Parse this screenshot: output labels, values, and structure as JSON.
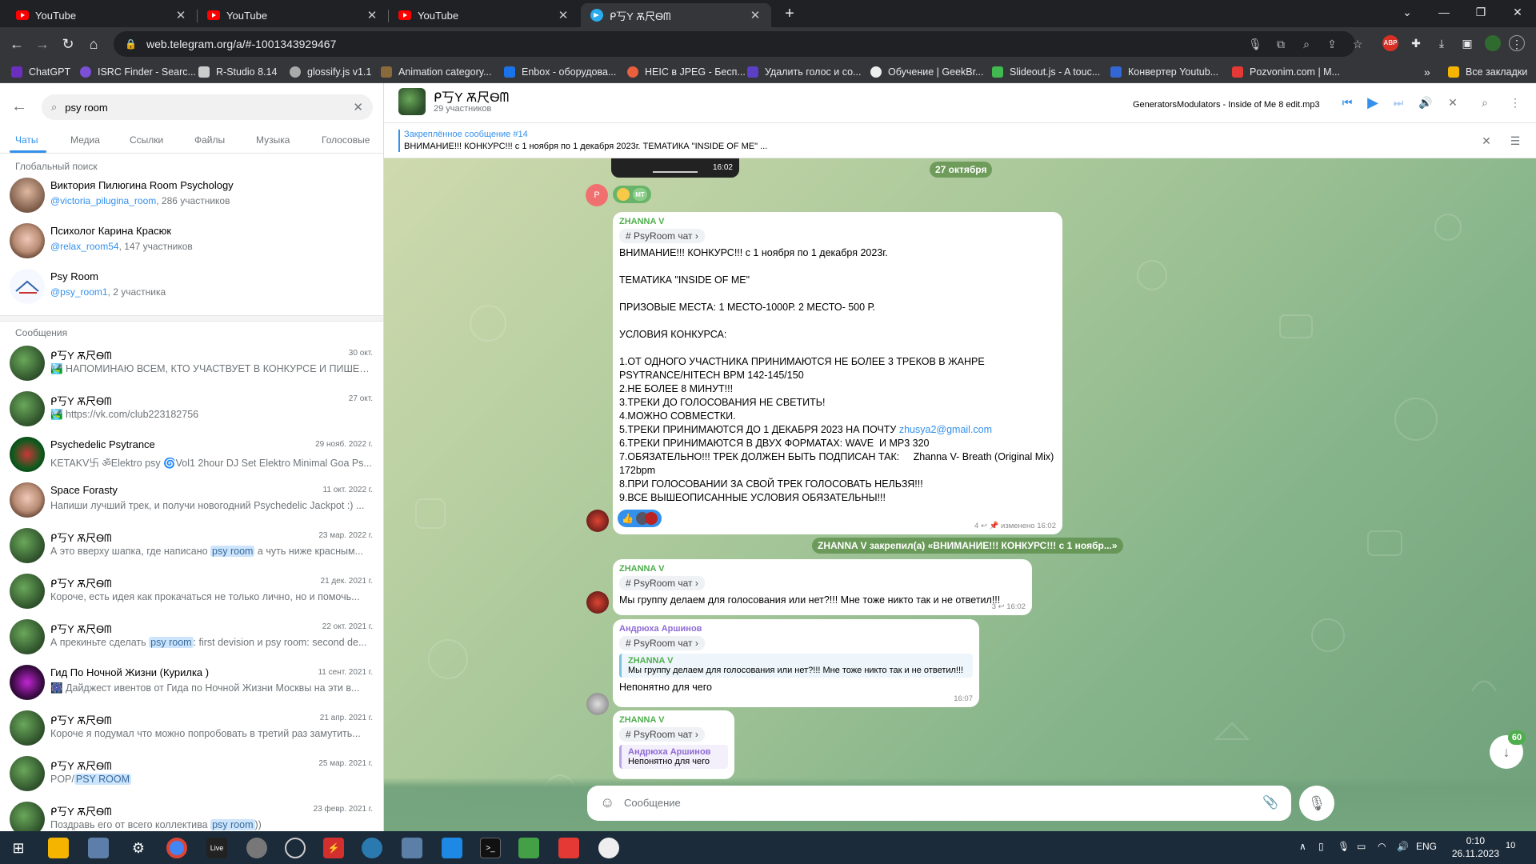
{
  "browser": {
    "tabs": [
      {
        "title": "YouTube",
        "type": "youtube"
      },
      {
        "title": "YouTube",
        "type": "youtube"
      },
      {
        "title": "YouTube",
        "type": "youtube"
      },
      {
        "title": "ᑭ丂Y Ѫ尺Ѳᗰ",
        "type": "telegram",
        "active": true
      }
    ],
    "url": "web.telegram.org/a/#-1001343929467",
    "bookmarks": [
      "ChatGPT",
      "ISRC Finder - Searc...",
      "R-Studio 8.14",
      "glossify.js v1.1",
      "Animation category...",
      "Enbox - оборудова...",
      "HEIC в JPEG - Бесп...",
      "Удалить голос и со...",
      "Обучение | GeekBr...",
      "Slideout.js - A touc...",
      "Конвертер Youtub...",
      "Pozvonim.com | М..."
    ],
    "bookmarks_more": "»",
    "all_bookmarks": "Все закладки"
  },
  "left": {
    "search_value": "psy room",
    "filter_tabs": [
      "Чаты",
      "Медиа",
      "Ссылки",
      "Файлы",
      "Музыка",
      "Голосовые"
    ],
    "global_title": "Глобальный поиск",
    "global": [
      {
        "name": "Виктория Пилюгина Room Psychology",
        "link": "@victoria_pilugina_room",
        "extra": ", 286 участников"
      },
      {
        "name": "Психолог Карина Красюк",
        "link": "@relax_room54",
        "extra": ", 147 участников"
      },
      {
        "name": "Psy Room",
        "link": "@psy_room1",
        "extra": ", 2 участника"
      }
    ],
    "messages_title": "Сообщения",
    "messages": [
      {
        "name": "ᑭ丂Y Ѫ尺Ѳᗰ",
        "date": "30 окт.",
        "pre": "🏞️ НАПОМИНАЮ ВСЕМ, КТО УЧАСТВУЕТ В КОНКУРСЕ И ПИШЕТ ...",
        "hl": "",
        "post": ""
      },
      {
        "name": "ᑭ丂Y Ѫ尺Ѳᗰ",
        "date": "27 окт.",
        "pre": "🏞️ https://vk.com/club223182756",
        "hl": "",
        "post": ""
      },
      {
        "name": "Psychedelic Psytrance",
        "date": "29 нояб. 2022 г.",
        "pre": "KETAKV卐 ॐElektro psy 🌀Vol1 2hour DJ Set Elektro Minimal Goa Ps...",
        "hl": "",
        "post": ""
      },
      {
        "name": "Space Forasty",
        "date": "11 окт. 2022 г.",
        "pre": "Напиши лучший трек, и получи новогодний Psychedelic Jackpot :) ...",
        "hl": "",
        "post": ""
      },
      {
        "name": "ᑭ丂Y Ѫ尺Ѳᗰ",
        "date": "23 мар. 2022 г.",
        "pre": "А это вверху шапка, где написано ",
        "hl": "psy room",
        "post": " а чуть ниже красным..."
      },
      {
        "name": "ᑭ丂Y Ѫ尺Ѳᗰ",
        "date": "21 дек. 2021 г.",
        "pre": "Короче, есть идея как прокачаться не только лично, но и помочь...",
        "hl": "",
        "post": ""
      },
      {
        "name": "ᑭ丂Y Ѫ尺Ѳᗰ",
        "date": "22 окт. 2021 г.",
        "pre": "А прекиньте сделать ",
        "hl": "psy room",
        "post": ": first devision и psy room: second de..."
      },
      {
        "name": "Гид По Ночной Жизни (Курилка )",
        "date": "11 сент. 2021 г.",
        "pre": "🎆 Дайджест ивентов от Гида по Ночной Жизни Москвы на эти в...",
        "hl": "",
        "post": ""
      },
      {
        "name": "ᑭ丂Y Ѫ尺Ѳᗰ",
        "date": "21 апр. 2021 г.",
        "pre": "Короче я подумал что можно попробовать в третий раз замутить...",
        "hl": "",
        "post": ""
      },
      {
        "name": "ᑭ丂Y Ѫ尺Ѳᗰ",
        "date": "25 мар. 2021 г.",
        "pre": "POP/",
        "hl": "PSY ROOM",
        "post": ""
      },
      {
        "name": "ᑭ丂Y Ѫ尺Ѳᗰ",
        "date": "23 февр. 2021 г.",
        "pre": "Поздравь его от всего коллектива ",
        "hl": "psy room",
        "post": "))"
      }
    ]
  },
  "chat": {
    "title": "ᑭ丂Y Ѫ尺Ѳᗰ",
    "members": "29 участников",
    "audio": "GeneratorsModulators - Inside of Me 8 edit.mp3",
    "pinned_title": "Закреплённое сообщение #14",
    "pinned_text": "ВНИМАНИЕ!!! КОНКУРС!!! с 1 ноября по 1 декабря 2023г. ТЕМАТИКА \"INSIDE OF ME\" ...",
    "video_time": "16:02",
    "reaction_small": "МТ",
    "date_chip": "27 октября",
    "post": {
      "author": "ZHANNA V",
      "topic": "PsyRoom чат",
      "line1": "ВНИМАНИЕ!!! КОНКУРС!!! с 1 ноября по 1 декабря 2023г.",
      "line2": "ТЕМАТИКА \"INSIDE OF ME\"",
      "line3": "ПРИЗОВЫЕ МЕСТА: 1 МЕСТО-1000Р. 2 МЕСТО- 500 Р.",
      "line4": "УСЛОВИЯ КОНКУРСА:",
      "line5": "1.ОТ ОДНОГО УЧАСТНИКА ПРИНИМАЮТСЯ НЕ БОЛЕЕ 3 ТРЕКОВ В ЖАНРЕ PSYTRANCE/HITECH BPM 142-145/150",
      "line6": "2.НЕ БОЛЕЕ 8 МИНУТ!!!",
      "line7": "3.ТРЕКИ ДО ГОЛОСОВАНИЯ НЕ СВЕТИТЬ!",
      "line8": "4.МОЖНО СОВМЕСТКИ.",
      "line9": "5.ТРЕКИ ПРИНИМАЮТСЯ ДО 1 ДЕКАБРЯ 2023 НА ПОЧТУ ",
      "email": "zhusya2@gmail.com",
      "line10": "6.ТРЕКИ ПРИНИМАЮТСЯ В ДВУХ ФОРМАТАХ: WAVE  И МР3 320",
      "line11": "7.ОБЯЗАТЕЛЬНО!!! ТРЕК ДОЛЖЕН БЫТЬ ПОДПИСАН ТАК:     Zhanna V- Breath (Original Mix) 172bpm",
      "line12": "8.ПРИ ГОЛОСОВАНИИ ЗА СВОЙ ТРЕК ГОЛОСОВАТЬ НЕЛЬЗЯ!!!",
      "line13": "9.ВСЕ ВЫШЕОПИСАННЫЕ УСЛОВИЯ ОБЯЗАТЕЛЬНЫ!!!",
      "meta": "4 ↩ 📌 изменено 16:02"
    },
    "service": "ZHANNA V закрепил(а) «ВНИМАНИЕ!!! КОНКУРС!!! с 1 ноябр...»",
    "m2": {
      "author": "ZHANNA V",
      "topic": "PsyRoom чат",
      "text": "Мы группу делаем для голосования или нет?!!! Мне тоже никто так и не ответил!!!",
      "meta": "3 ↩ 16:02"
    },
    "m3": {
      "author": "Андрюха Аршинов",
      "topic": "PsyRoom чат",
      "reply_author": "ZHANNA V",
      "reply_text": "Мы группу делаем для голосования или нет?!!! Мне тоже никто так и не ответил!!!",
      "text": "Непонятно для чего",
      "meta": "16:07"
    },
    "m4": {
      "author": "ZHANNA V",
      "topic": "PsyRoom чат",
      "reply_author": "Андрюха Аршинов",
      "reply_text": "Непонятно для чего"
    },
    "composer_placeholder": "Сообщение",
    "unread": "60"
  },
  "taskbar": {
    "lang": "ENG",
    "time": "0:10",
    "date": "26.11.2023",
    "notif": "10",
    "live_label": "Live"
  }
}
